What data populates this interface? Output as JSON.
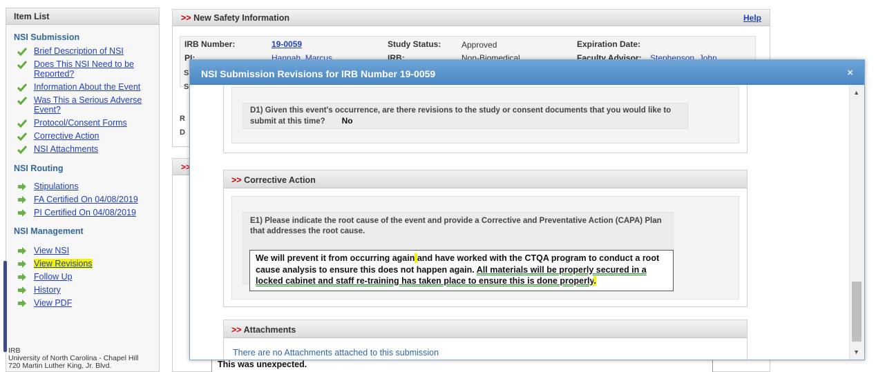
{
  "sidebar": {
    "title": "Item List",
    "sections": [
      {
        "heading": "NSI Submission",
        "items": [
          "Brief Description of NSI",
          "Does This NSI Need to be Reported?",
          "Information About the Event",
          "Was This a Serious Adverse Event?",
          "Protocol/Consent Forms",
          "Corrective Action",
          "NSI Attachments"
        ]
      },
      {
        "heading": "NSI Routing",
        "items": [
          "Stipulations",
          "FA Certified On 04/08/2019",
          "PI Certified On 04/08/2019"
        ]
      },
      {
        "heading": "NSI Management",
        "items": [
          "View NSI",
          "View Revisions",
          "Follow Up",
          "History",
          "View PDF"
        ]
      }
    ],
    "address": [
      "IRB",
      "University of North Carolina - Chapel Hill",
      "720 Martin Luther King, Jr. Blvd."
    ]
  },
  "main": {
    "title": "New Safety Information",
    "arrow": ">>",
    "help": "Help",
    "irb_label": "IRB Number:",
    "irb_value": "19-0059",
    "status_label": "Study Status:",
    "status_value": "Approved",
    "expiration_label": "Expiration Date:",
    "pi_label": "PI:",
    "pi_value": "Hannah, Marcus",
    "irb_type_label": "IRB:",
    "irb_type_value": "Non-Biomedical",
    "advisor_label": "Faculty Advisor:",
    "advisor_value": "Stephenson, John",
    "clipped": [
      "S",
      "S",
      "R",
      "D"
    ],
    "second_arrow": ">>",
    "unexpected_text": "This was unexpected."
  },
  "modal": {
    "title": "NSI Submission Revisions for IRB Number 19-0059",
    "close": "×",
    "d1": {
      "question": "D1) Given this event's occurrence, are there revisions to the study or consent documents that you would like to submit at this time?",
      "answer": "No"
    },
    "corrective": {
      "header": "Corrective Action",
      "arrow": ">>",
      "question": "E1) Please indicate the root cause of the event and provide a Corrective and Preventative Action (CAPA) Plan that addresses the root cause.",
      "answer_part1": "We will prevent it from occurring again",
      "answer_part2": "and have worked with the CTQA program to conduct a root cause analysis to ensure this does not happen again.",
      "answer_part3": "All materials will be properly secured in a locked cabinet and staff re-training has taken place to ensure this is done properly"
    },
    "attachments": {
      "header": "Attachments",
      "arrow": ">>",
      "message": "There are no Attachments attached to this submission"
    }
  },
  "colors": {
    "modal_header": "#5b96cc",
    "link": "#1f3fbf",
    "highlight": "#f5f500",
    "check": "#5fae3a",
    "arrow_green": "#6ab04a",
    "gt_red": "#cc0000"
  }
}
